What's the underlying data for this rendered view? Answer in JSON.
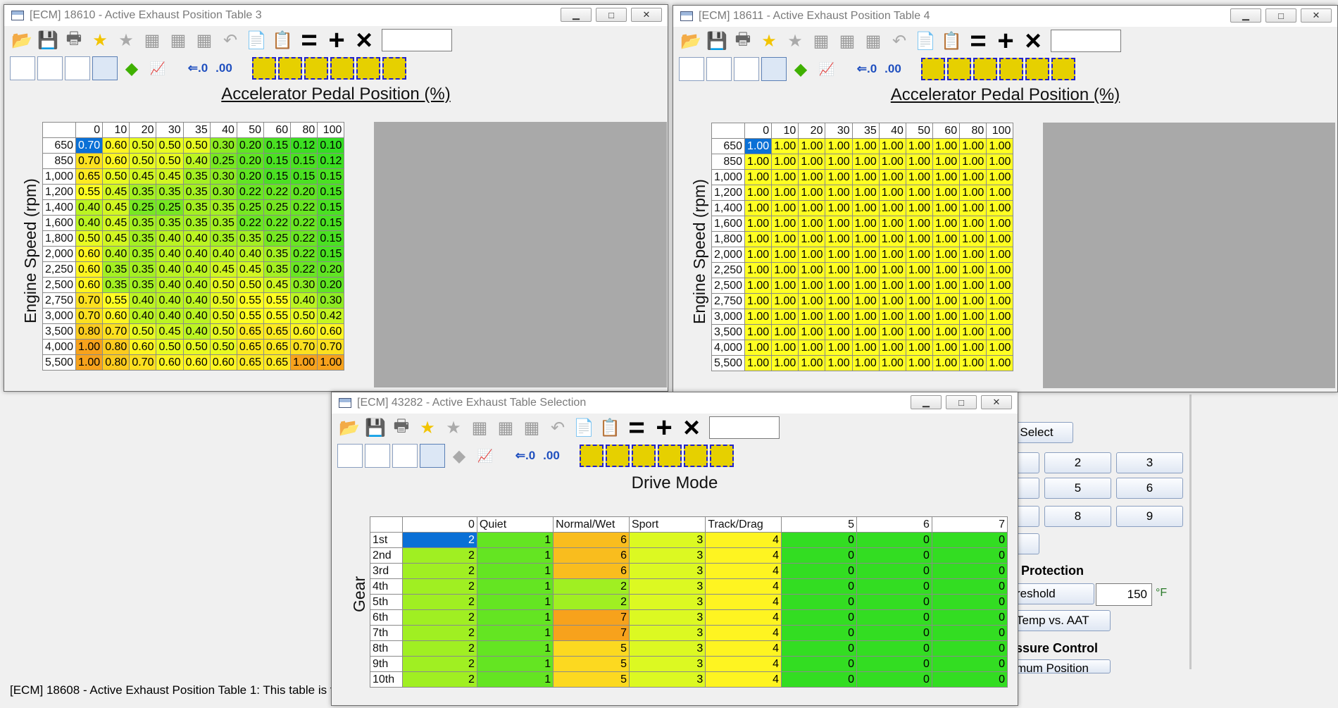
{
  "colors": {
    "blue_sel": "#0a70d6",
    "green": "#33dd22",
    "yellow": "#ffff22",
    "orange": "#f7a21c"
  },
  "status_bar": {
    "text": "[ECM] 18608 - Active Exhaust Position Table 1: This table is t"
  },
  "background_panel": {
    "select_label": "Select",
    "keypad": [
      "2",
      "3",
      "5",
      "6",
      "8",
      "9"
    ],
    "protection_label": "Protection",
    "threshold_label": "reshold",
    "threshold_value": "150",
    "threshold_unit": "°F",
    "temp_btn": "Temp vs. AAT",
    "pressure_label": "essure Control",
    "position_btn": "mum Position"
  },
  "window1": {
    "title": "[ECM] 18610 - Active Exhaust Position Table 3",
    "x_label": "Accelerator Pedal Position (%)",
    "y_label": "Engine Speed (rpm)",
    "cols": [
      "0",
      "10",
      "20",
      "30",
      "35",
      "40",
      "50",
      "60",
      "80",
      "100"
    ],
    "rows": [
      "650",
      "850",
      "1,000",
      "1,200",
      "1,400",
      "1,600",
      "1,800",
      "2,000",
      "2,250",
      "2,500",
      "2,750",
      "3,000",
      "3,500",
      "4,000",
      "5,500"
    ],
    "cells": [
      [
        "0.70",
        "0.60",
        "0.50",
        "0.50",
        "0.50",
        "0.30",
        "0.20",
        "0.15",
        "0.12",
        "0.10"
      ],
      [
        "0.70",
        "0.60",
        "0.50",
        "0.50",
        "0.40",
        "0.25",
        "0.20",
        "0.15",
        "0.15",
        "0.12"
      ],
      [
        "0.65",
        "0.50",
        "0.45",
        "0.45",
        "0.35",
        "0.30",
        "0.20",
        "0.15",
        "0.15",
        "0.15"
      ],
      [
        "0.55",
        "0.45",
        "0.35",
        "0.35",
        "0.35",
        "0.30",
        "0.22",
        "0.22",
        "0.20",
        "0.15"
      ],
      [
        "0.40",
        "0.45",
        "0.25",
        "0.25",
        "0.35",
        "0.35",
        "0.25",
        "0.25",
        "0.22",
        "0.15"
      ],
      [
        "0.40",
        "0.45",
        "0.35",
        "0.35",
        "0.35",
        "0.35",
        "0.22",
        "0.22",
        "0.22",
        "0.15"
      ],
      [
        "0.50",
        "0.45",
        "0.35",
        "0.40",
        "0.40",
        "0.35",
        "0.35",
        "0.25",
        "0.22",
        "0.15"
      ],
      [
        "0.60",
        "0.40",
        "0.35",
        "0.40",
        "0.40",
        "0.40",
        "0.40",
        "0.35",
        "0.22",
        "0.15"
      ],
      [
        "0.60",
        "0.35",
        "0.35",
        "0.40",
        "0.40",
        "0.45",
        "0.45",
        "0.35",
        "0.22",
        "0.20"
      ],
      [
        "0.60",
        "0.35",
        "0.35",
        "0.40",
        "0.40",
        "0.50",
        "0.50",
        "0.45",
        "0.30",
        "0.20"
      ],
      [
        "0.70",
        "0.55",
        "0.40",
        "0.40",
        "0.40",
        "0.50",
        "0.55",
        "0.55",
        "0.40",
        "0.30"
      ],
      [
        "0.70",
        "0.60",
        "0.40",
        "0.40",
        "0.40",
        "0.50",
        "0.55",
        "0.55",
        "0.50",
        "0.42"
      ],
      [
        "0.80",
        "0.70",
        "0.50",
        "0.45",
        "0.40",
        "0.50",
        "0.65",
        "0.65",
        "0.60",
        "0.60"
      ],
      [
        "1.00",
        "0.80",
        "0.60",
        "0.50",
        "0.50",
        "0.50",
        "0.65",
        "0.65",
        "0.70",
        "0.70"
      ],
      [
        "1.00",
        "0.80",
        "0.70",
        "0.60",
        "0.60",
        "0.60",
        "0.65",
        "0.65",
        "1.00",
        "1.00"
      ]
    ]
  },
  "window2": {
    "title": "[ECM] 18611 - Active Exhaust Position Table 4",
    "x_label": "Accelerator Pedal Position (%)",
    "y_label": "Engine Speed (rpm)",
    "cols": [
      "0",
      "10",
      "20",
      "30",
      "35",
      "40",
      "50",
      "60",
      "80",
      "100"
    ],
    "rows": [
      "650",
      "850",
      "1,000",
      "1,200",
      "1,400",
      "1,600",
      "1,800",
      "2,000",
      "2,250",
      "2,500",
      "2,750",
      "3,000",
      "3,500",
      "4,000",
      "5,500"
    ],
    "fill_value": "1.00"
  },
  "window3": {
    "title": "[ECM] 43282 - Active Exhaust Table Selection",
    "x_label": "Drive Mode",
    "y_label": "Gear",
    "cols": [
      "0",
      "Quiet",
      "Normal/Wet",
      "Sport",
      "Track/Drag",
      "5",
      "6",
      "7"
    ],
    "rows": [
      "1st",
      "2nd",
      "3rd",
      "4th",
      "5th",
      "6th",
      "7th",
      "8th",
      "9th",
      "10th"
    ],
    "cells": [
      [
        "2",
        "1",
        "6",
        "3",
        "4",
        "0",
        "0",
        "0"
      ],
      [
        "2",
        "1",
        "6",
        "3",
        "4",
        "0",
        "0",
        "0"
      ],
      [
        "2",
        "1",
        "6",
        "3",
        "4",
        "0",
        "0",
        "0"
      ],
      [
        "2",
        "1",
        "2",
        "3",
        "4",
        "0",
        "0",
        "0"
      ],
      [
        "2",
        "1",
        "2",
        "3",
        "4",
        "0",
        "0",
        "0"
      ],
      [
        "2",
        "1",
        "7",
        "3",
        "4",
        "0",
        "0",
        "0"
      ],
      [
        "2",
        "1",
        "7",
        "3",
        "4",
        "0",
        "0",
        "0"
      ],
      [
        "2",
        "1",
        "5",
        "3",
        "4",
        "0",
        "0",
        "0"
      ],
      [
        "2",
        "1",
        "5",
        "3",
        "4",
        "0",
        "0",
        "0"
      ],
      [
        "2",
        "1",
        "5",
        "3",
        "4",
        "0",
        "0",
        "0"
      ]
    ]
  }
}
